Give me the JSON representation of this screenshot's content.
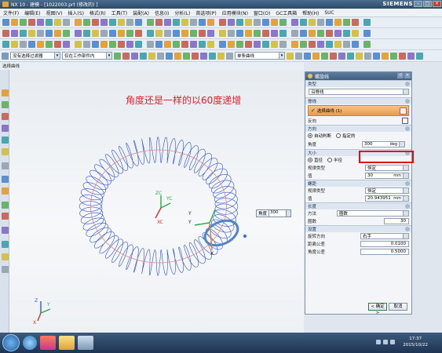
{
  "window": {
    "title": "NX 10 - 建模 - [1022003.prt (修改的) ]",
    "brand": "SIEMENS"
  },
  "menubar": [
    "文件(F)",
    "编辑(E)",
    "视图(V)",
    "插入(S)",
    "格式(R)",
    "工具(T)",
    "装配(A)",
    "信息(I)",
    "分析(L)",
    "首选项(P)",
    "应用模块(N)",
    "窗口(O)",
    "GC工具箱",
    "帮助(H)",
    "SUC"
  ],
  "filters": {
    "type_filter": "没有选择过滤器",
    "scope": "仅在工作部件内",
    "curve_rule": "单条曲线"
  },
  "cue_line": "选择曲线",
  "annotation": "角度还是一样的以60度递增",
  "angle_tag": {
    "label": "角度",
    "value": "300"
  },
  "dialog": {
    "title": "螺旋线",
    "sections": {
      "type": {
        "label": "类型",
        "value": "沿脊线"
      },
      "spine": {
        "label": "脊线",
        "select_label": "选择曲线 (1)",
        "reverse_label": "反向"
      },
      "direction": {
        "label": "方向",
        "opt1": "自动判断",
        "opt2": "指定的",
        "angle_label": "角度",
        "angle_value": "300",
        "angle_unit": "deg"
      },
      "size": {
        "label": "大小",
        "opt1": "直径",
        "opt2": "半径",
        "law_label": "规律类型",
        "law_value": "恒定",
        "value_label": "值",
        "value": "30",
        "unit": "mm"
      },
      "pitch": {
        "label": "螺距",
        "law_label": "规律类型",
        "law_value": "恒定",
        "value_label": "值",
        "value": "20.943951",
        "unit": "mm"
      },
      "length": {
        "label": "长度",
        "method_label": "方法",
        "method_value": "圈数",
        "turns_label": "圈数",
        "turns_value": "30"
      },
      "settings": {
        "label": "设置",
        "hand_label": "旋转方向",
        "hand_value": "右手",
        "dist_tol_label": "距离公差",
        "dist_tol_value": "0.0100",
        "angle_tol_label": "角度公差",
        "angle_tol_value": "0.5000"
      }
    },
    "ok": "< 确定 >",
    "cancel": "取消"
  },
  "axes": {
    "zc": "ZC",
    "yc": "YC",
    "xc": "XC",
    "y": "Y",
    "x": "X",
    "z": "Z"
  },
  "clock": {
    "time": "17:37",
    "date": "2015/10/22"
  }
}
